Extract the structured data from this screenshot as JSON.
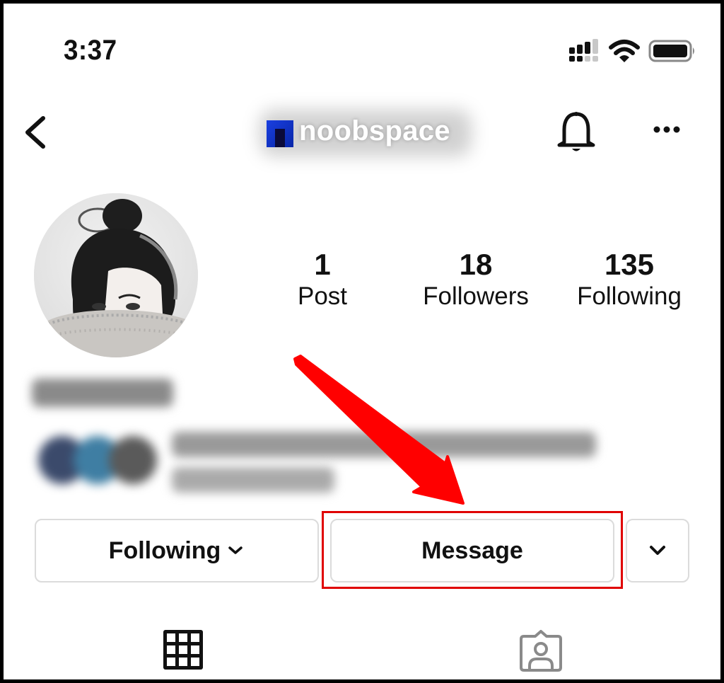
{
  "status_bar": {
    "time": "3:37",
    "icons": [
      "cellular-signal-icon",
      "wifi-icon",
      "battery-icon"
    ]
  },
  "header": {
    "back_icon": "chevron-left-icon",
    "username": "noobspace",
    "notification_icon": "bell-icon",
    "more_icon": "more-horizontal-icon"
  },
  "profile": {
    "avatar": "profile-photo",
    "stats": [
      {
        "value": "1",
        "label": "Post"
      },
      {
        "value": "18",
        "label": "Followers"
      },
      {
        "value": "135",
        "label": "Following"
      }
    ],
    "bio_blurred": true,
    "mutual_followers_blurred": true
  },
  "actions": {
    "following_label": "Following",
    "message_label": "Message",
    "more_icon": "chevron-down-icon"
  },
  "annotation": {
    "color": "#ff0000",
    "target": "Message"
  },
  "tabs": [
    {
      "name": "posts-grid",
      "icon": "grid-icon",
      "active": true
    },
    {
      "name": "tagged",
      "icon": "tagged-person-icon",
      "active": false
    }
  ]
}
